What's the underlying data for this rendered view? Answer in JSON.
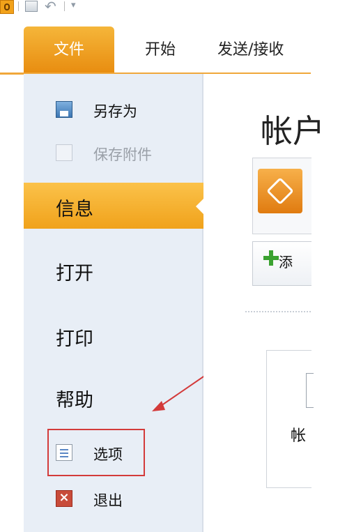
{
  "ribbon": {
    "tabs": [
      "文件",
      "开始",
      "发送/接收"
    ]
  },
  "backstage": {
    "commands_top": [
      "另存为",
      "保存附件"
    ],
    "nav": [
      "信息",
      "打开",
      "打印",
      "帮助"
    ],
    "commands_bottom": [
      "选项",
      "退出"
    ]
  },
  "content": {
    "title_fragment": "帐户",
    "add_button_fragment": "添",
    "panel_label_fragment": "帐"
  },
  "colors": {
    "accent": "#f0a21b",
    "annotation": "#d33a3a",
    "backstage_bg": "#e8eef6"
  }
}
